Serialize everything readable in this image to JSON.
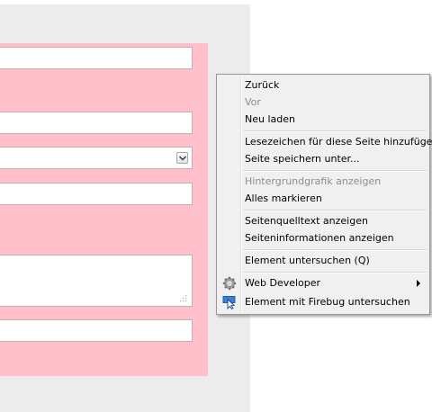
{
  "menu": {
    "items": [
      {
        "label": "Zurück",
        "disabled": false
      },
      {
        "label": "Vor",
        "disabled": true
      },
      {
        "label": "Neu laden",
        "disabled": false
      },
      {
        "label": "Lesezeichen für diese Seite hinzufügen",
        "disabled": false
      },
      {
        "label": "Seite speichern unter...",
        "disabled": false
      },
      {
        "label": "Hintergrundgrafik anzeigen",
        "disabled": true
      },
      {
        "label": "Alles markieren",
        "disabled": false
      },
      {
        "label": "Seitenquelltext anzeigen",
        "disabled": false
      },
      {
        "label": "Seiteninformationen anzeigen",
        "disabled": false
      },
      {
        "label": "Element untersuchen (Q)",
        "disabled": false
      },
      {
        "label": "Web Developer",
        "disabled": false,
        "submenu": true,
        "icon": "gear-icon"
      },
      {
        "label": "Element mit Firebug untersuchen",
        "disabled": false,
        "icon": "firebug-inspect-icon"
      }
    ]
  },
  "colors": {
    "form_background": "#ffc0cb",
    "page_background": "#ececec",
    "menu_background": "#f0f0f0"
  }
}
